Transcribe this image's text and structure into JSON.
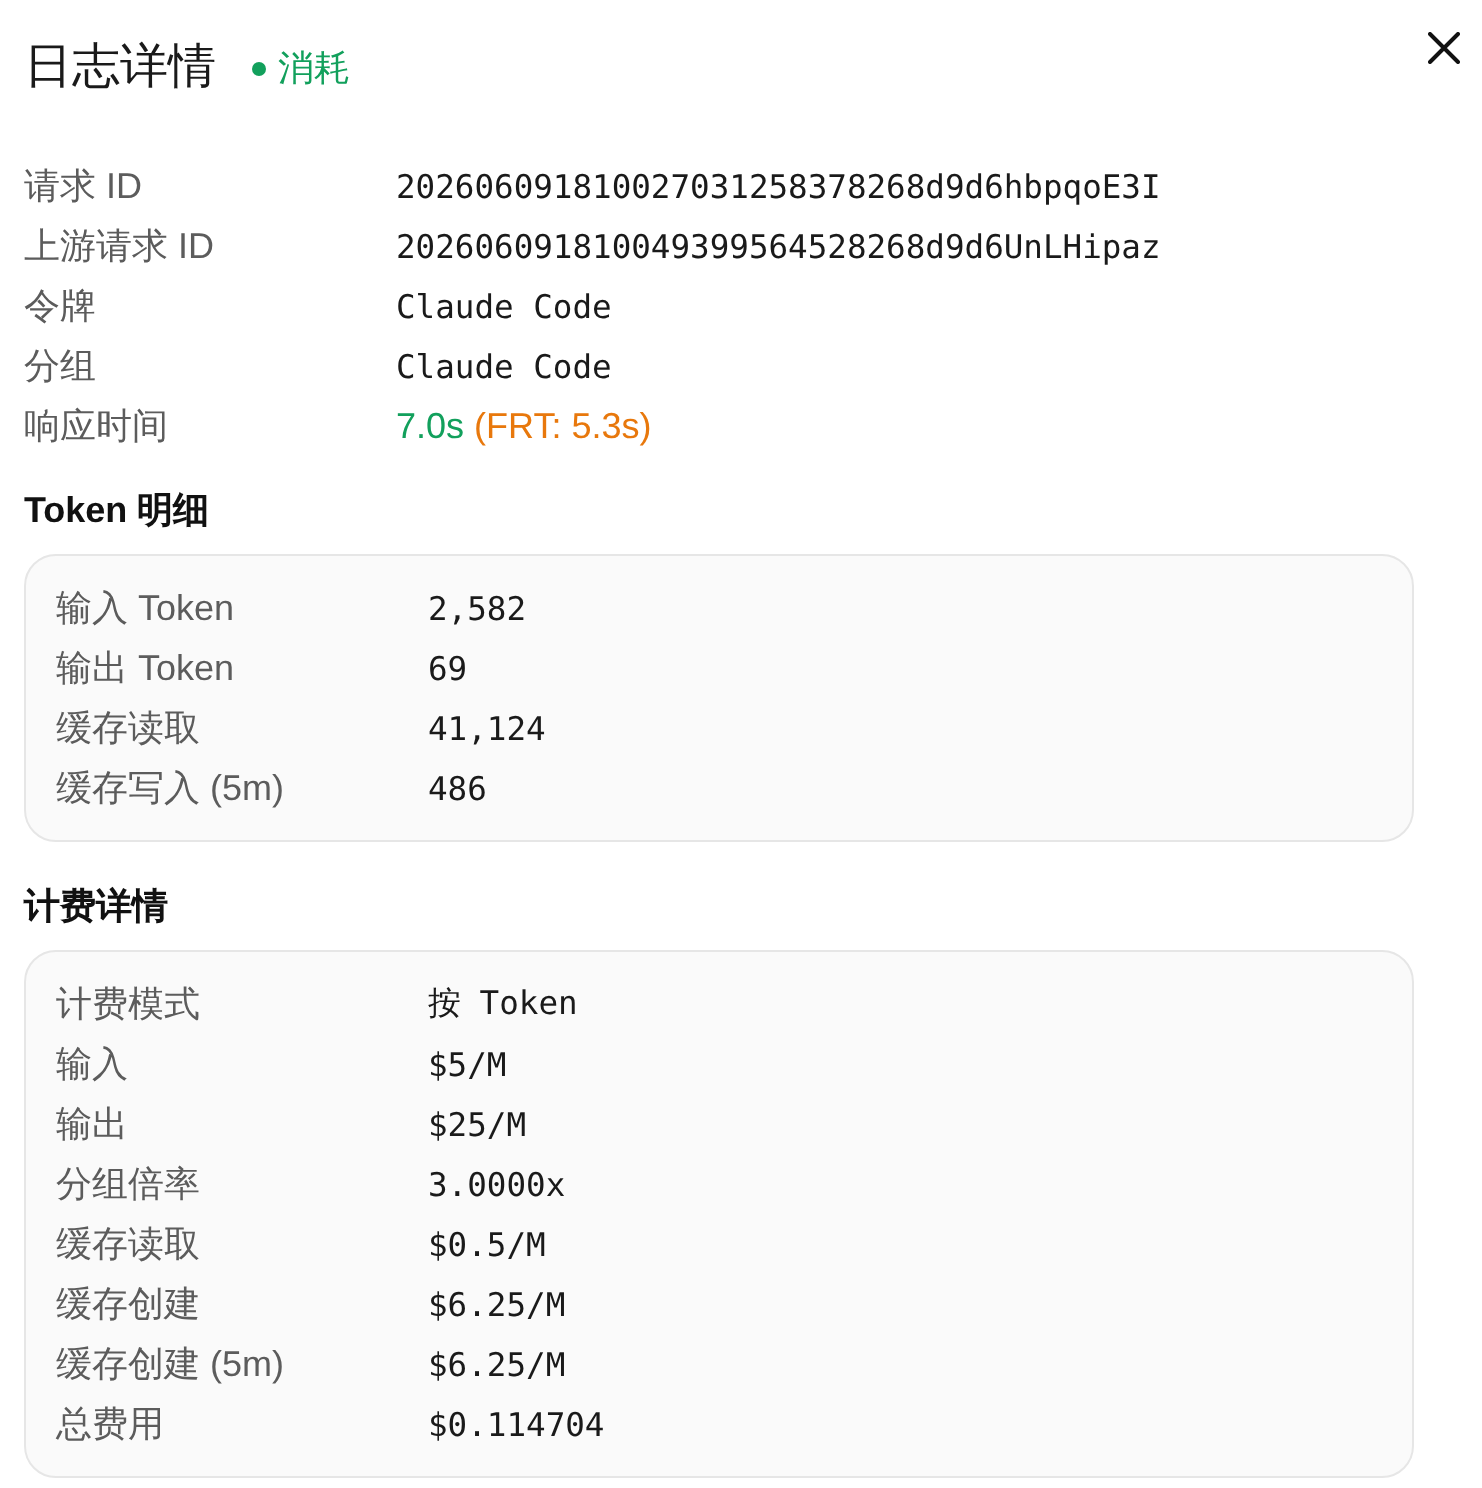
{
  "dialog": {
    "title": "日志详情",
    "status": {
      "label": "消耗"
    }
  },
  "details": [
    {
      "label": "请求 ID",
      "value": "202606091810027031258378268d9d6hbpqoE3I"
    },
    {
      "label": "上游请求 ID",
      "value": "202606091810049399564528268d9d6UnLHipaz"
    },
    {
      "label": "令牌",
      "value": "Claude Code"
    },
    {
      "label": "分组",
      "value": "Claude Code"
    }
  ],
  "response_time": {
    "label": "响应时间",
    "value": "7.0s",
    "frt": "(FRT: 5.3s)"
  },
  "token_section": {
    "title": "Token 明细",
    "rows": [
      {
        "label": "输入 Token",
        "value": "2,582"
      },
      {
        "label": "输出 Token",
        "value": "69"
      },
      {
        "label": "缓存读取",
        "value": "41,124"
      },
      {
        "label": "缓存写入 (5m)",
        "value": "486"
      }
    ]
  },
  "billing_section": {
    "title": "计费详情",
    "rows": [
      {
        "label": "计费模式",
        "value": "按 Token"
      },
      {
        "label": "输入",
        "value": "$5/M"
      },
      {
        "label": "输出",
        "value": "$25/M"
      },
      {
        "label": "分组倍率",
        "value": "3.0000x"
      },
      {
        "label": "缓存读取",
        "value": "$0.5/M"
      },
      {
        "label": "缓存创建",
        "value": "$6.25/M"
      },
      {
        "label": "缓存创建 (5m)",
        "value": "$6.25/M"
      },
      {
        "label": "总费用",
        "value": "$0.114704"
      }
    ]
  }
}
